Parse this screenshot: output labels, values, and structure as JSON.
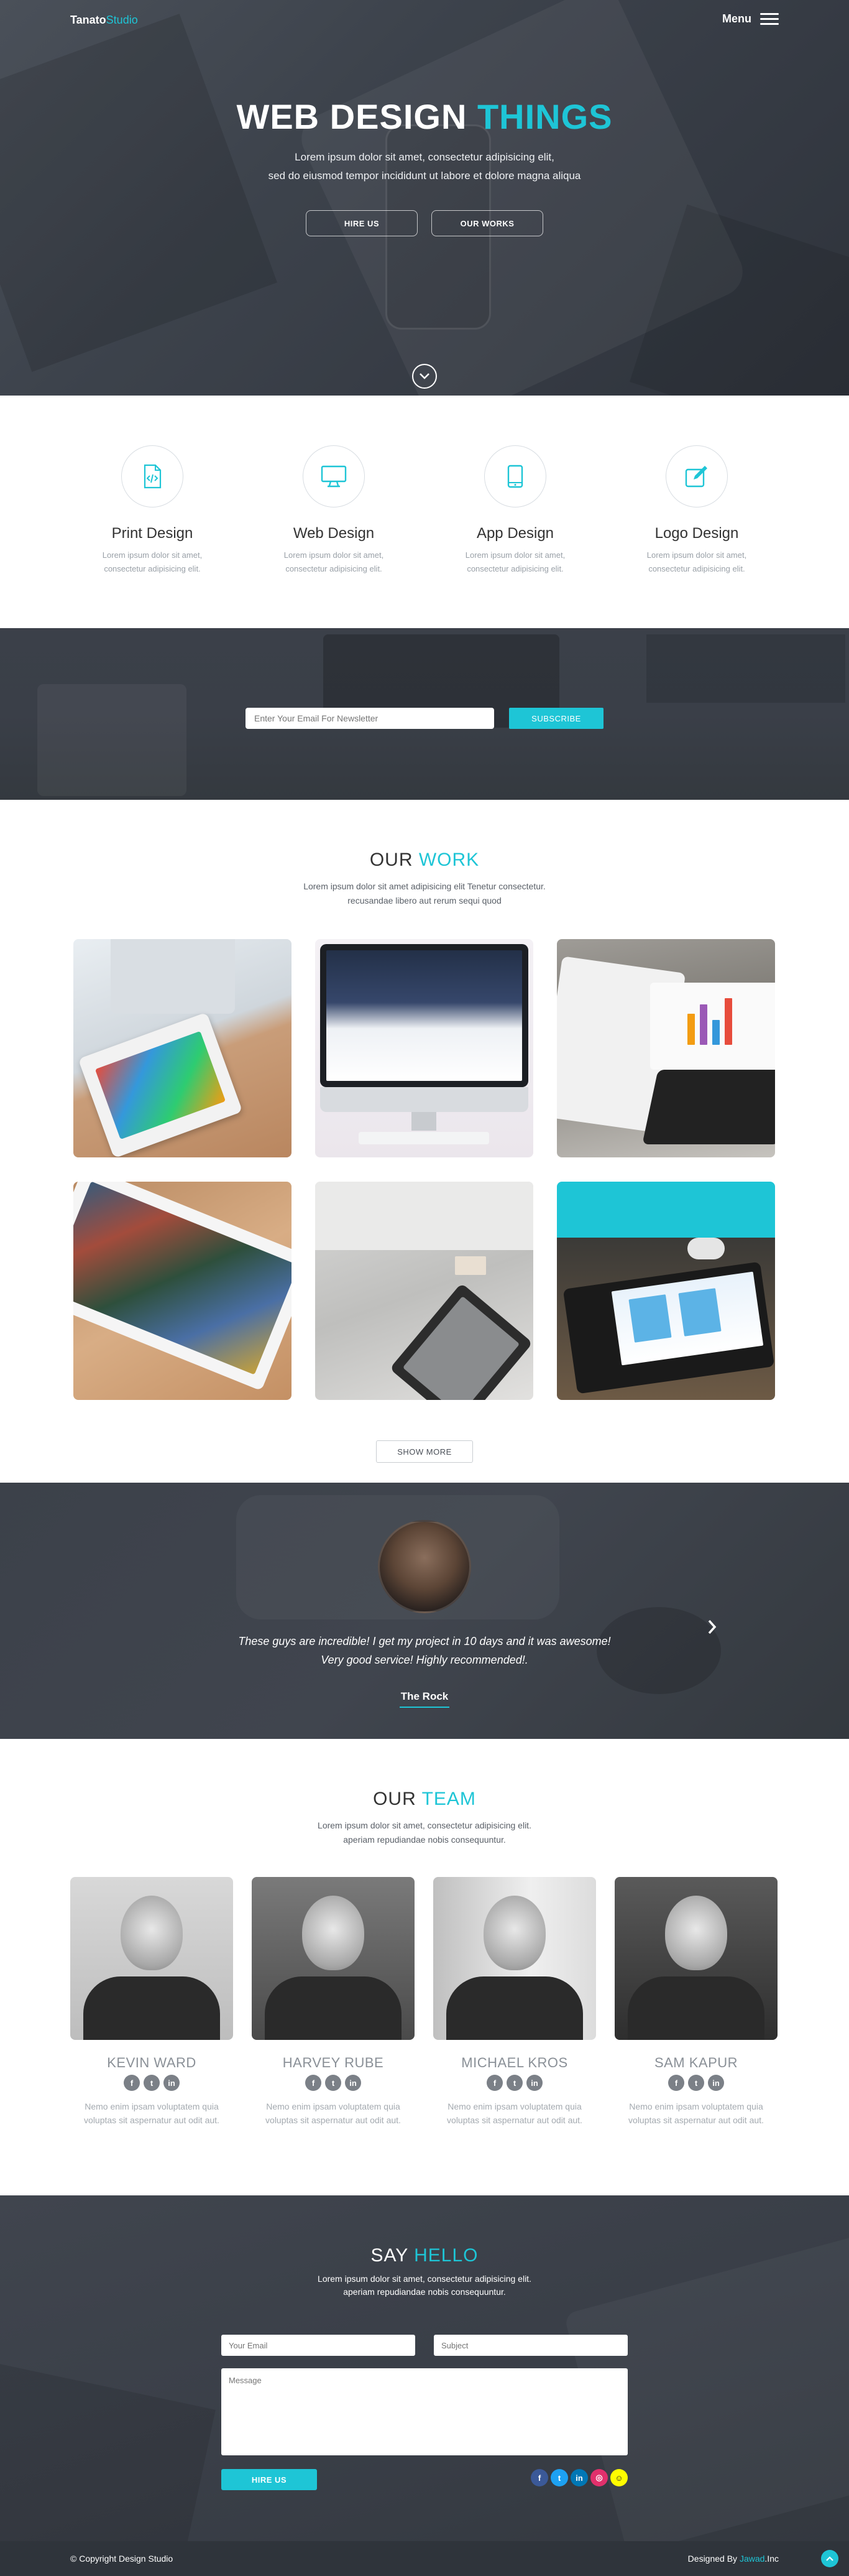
{
  "header": {
    "logo_part1": "Tanato",
    "logo_part2": "Studio",
    "menu_label": "Menu"
  },
  "hero": {
    "title_part1": "WEB DESIGN",
    "title_part2": "THINGS",
    "subtitle_line1": "Lorem ipsum dolor sit amet, consectetur adipisicing elit,",
    "subtitle_line2": "sed do eiusmod tempor incididunt ut labore et dolore magna aliqua",
    "hire_button": "HIRE US",
    "works_button": "OUR WORKS"
  },
  "services": [
    {
      "title": "Print Design",
      "desc_line1": "Lorem ipsum dolor sit amet,",
      "desc_line2": "consectetur adipisicing elit.",
      "icon": "code-file-icon"
    },
    {
      "title": "Web Design",
      "desc_line1": "Lorem ipsum dolor sit amet,",
      "desc_line2": "consectetur adipisicing elit.",
      "icon": "monitor-icon"
    },
    {
      "title": "App Design",
      "desc_line1": "Lorem ipsum dolor sit amet,",
      "desc_line2": "consectetur adipisicing elit.",
      "icon": "tablet-icon"
    },
    {
      "title": "Logo Design",
      "desc_line1": "Lorem ipsum dolor sit amet,",
      "desc_line2": "consectetur adipisicing elit.",
      "icon": "pencil-square-icon"
    }
  ],
  "newsletter": {
    "placeholder": "Enter Your Email For Newsletter",
    "button": "SUBSCRIBE"
  },
  "work": {
    "title_part1": "OUR",
    "title_part2": "WORK",
    "sub_line1": "Lorem ipsum dolor sit amet adipisicing elit Tenetur consectetur.",
    "sub_line2": "recusandae libero aut rerum sequi quod",
    "show_more": "SHOW MORE"
  },
  "testimonial": {
    "quote_line1": "These guys are incredible! I get my project in 10 days and it was awesome!",
    "quote_line2": "Very good service! Highly recommended!.",
    "author": "The Rock"
  },
  "team": {
    "title_part1": "OUR",
    "title_part2": "TEAM",
    "sub_line1": "Lorem ipsum dolor sit amet, consectetur adipisicing elit.",
    "sub_line2": "aperiam repudiandae nobis consequuntur.",
    "members": [
      {
        "name": "KEVIN WARD",
        "desc_line1": "Nemo enim ipsam voluptatem quia",
        "desc_line2": "voluptas sit aspernatur aut odit aut."
      },
      {
        "name": "HARVEY RUBE",
        "desc_line1": "Nemo enim ipsam voluptatem quia",
        "desc_line2": "voluptas sit aspernatur aut odit aut."
      },
      {
        "name": "MICHAEL KROS",
        "desc_line1": "Nemo enim ipsam voluptatem quia",
        "desc_line2": "voluptas sit aspernatur aut odit aut."
      },
      {
        "name": "SAM KAPUR",
        "desc_line1": "Nemo enim ipsam voluptatem quia",
        "desc_line2": "voluptas sit aspernatur aut odit aut."
      }
    ]
  },
  "contact": {
    "title_part1": "SAY",
    "title_part2": "HELLO",
    "sub_line1": "Lorem ipsum dolor sit amet, consectetur adipisicing elit.",
    "sub_line2": "aperiam repudiandae nobis consequuntur.",
    "email_placeholder": "Your Email",
    "subject_placeholder": "Subject",
    "message_placeholder": "Message",
    "hire_button": "HIRE US"
  },
  "footer": {
    "copyright": "© Copyright Design Studio",
    "designed_by": "Designed By",
    "designer": "Jawad",
    "designer_suffix": ".Inc"
  },
  "colors": {
    "accent": "#1ec5d6",
    "dark_bg": "#3a3f48",
    "facebook": "#3b5998",
    "twitter": "#1da1f2",
    "linkedin": "#0077b5",
    "instagram": "#e1306c",
    "snapchat": "#fffc00"
  }
}
